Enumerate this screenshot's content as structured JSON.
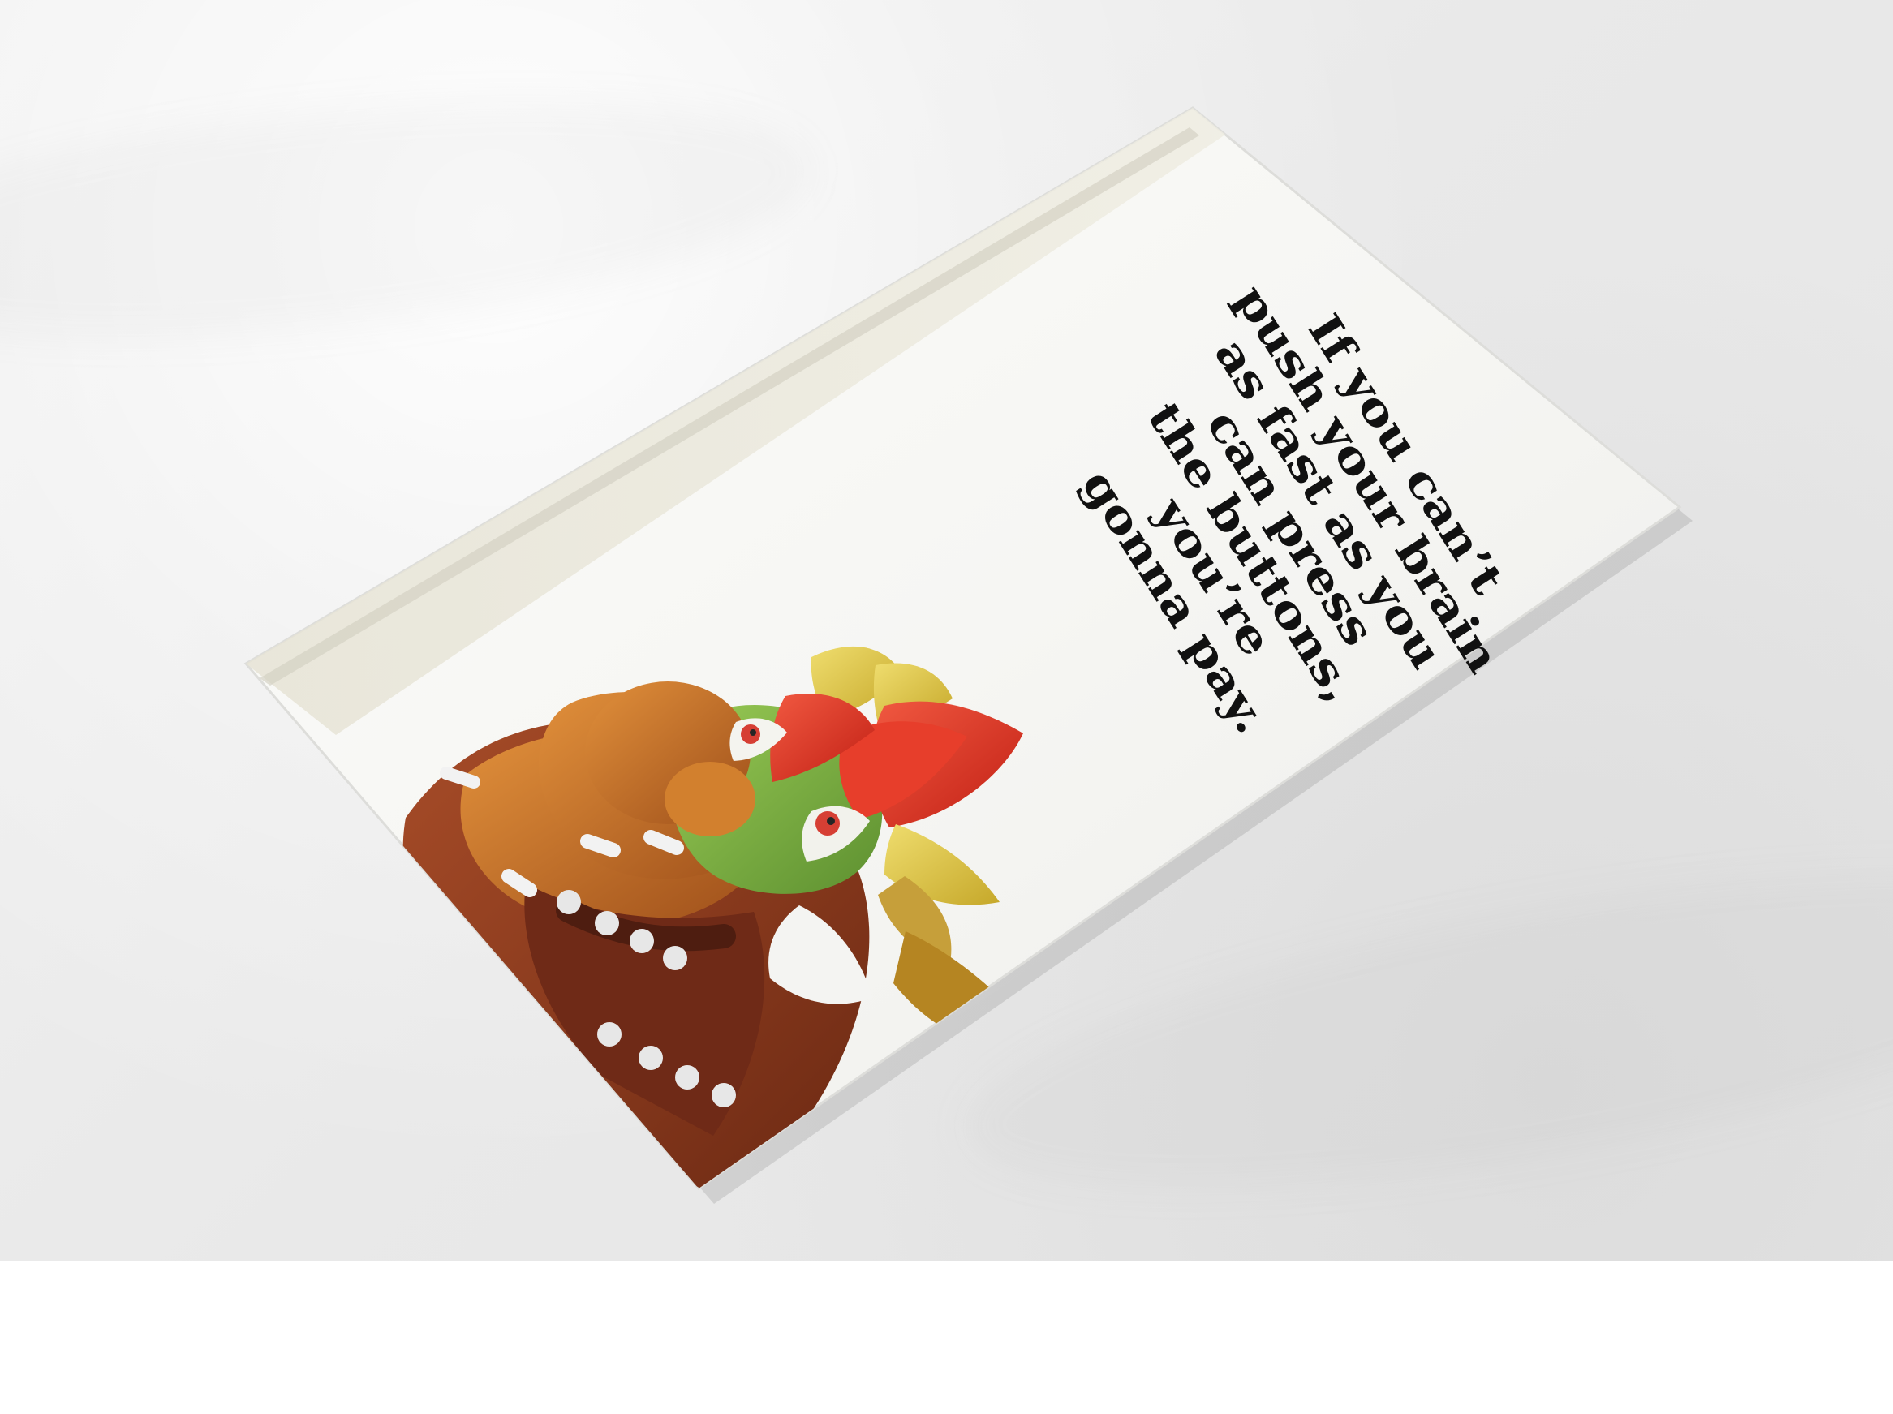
{
  "image": {
    "background_color": "#ececec",
    "card_color": "#f7f7f5",
    "accent_colors": {
      "bowser_orange": "#c06a24",
      "bowser_green": "#72a339",
      "bowser_red": "#d7321d",
      "horn_yellow": "#d9c337",
      "shell_brown": "#8f3d1f"
    }
  },
  "card": {
    "quote_lines": [
      "If you can’t",
      "push your brain",
      "as fast as you",
      "can press",
      "the buttons,",
      "you’re",
      "gonna pay."
    ],
    "illustration": "bowser-illustration"
  }
}
